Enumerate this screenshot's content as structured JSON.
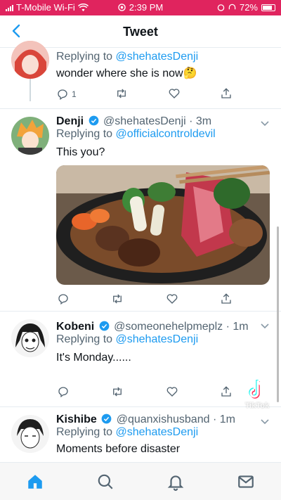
{
  "status_bar": {
    "carrier": "T-Mobile Wi-Fi",
    "time": "2:39 PM",
    "battery": "72%"
  },
  "header": {
    "title": "Tweet"
  },
  "tweets": [
    {
      "name": "",
      "reply_to_label": "Replying to",
      "mention": "@shehatesDenji",
      "text": "wonder where she is now🤔",
      "reply_count": "1"
    },
    {
      "name": "Denji",
      "handle": "@shehatesDenji",
      "time": "· 3m",
      "reply_to_label": "Replying to",
      "mention": "@officialcontroldevil",
      "text": "This you?"
    },
    {
      "name": "Kobeni",
      "handle": "@someonehelpmeplz",
      "time": "· 1m",
      "reply_to_label": "Replying to",
      "mention": "@shehatesDenji",
      "text": "It's Monday......"
    },
    {
      "name": "Kishibe",
      "handle": "@quanxishusband",
      "time": "· 1m",
      "reply_to_label": "Replying to",
      "mention": "@shehatesDenji",
      "text": "Moments before disaster"
    }
  ],
  "overlay": {
    "watermark": "TikTok"
  },
  "colors": {
    "status_bar": "#e0245e",
    "accent": "#1d9bf0",
    "muted": "#536471"
  },
  "icons": [
    "back-icon",
    "verified-icon",
    "reply-icon",
    "retweet-icon",
    "like-icon",
    "share-icon",
    "chevron-down-icon",
    "home-icon",
    "search-icon",
    "notifications-icon",
    "messages-icon"
  ]
}
